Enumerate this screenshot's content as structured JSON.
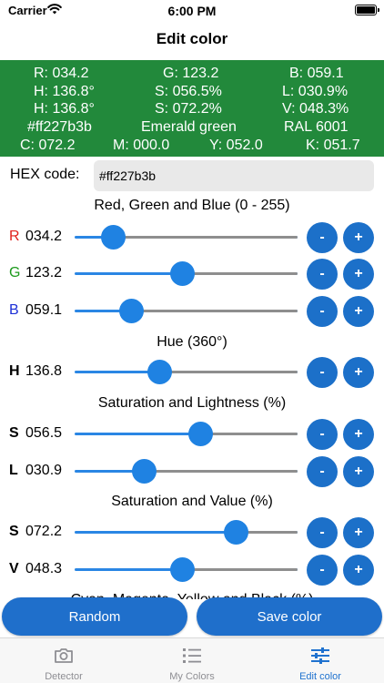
{
  "status_bar": {
    "carrier": "Carrier",
    "time": "6:00 PM"
  },
  "nav": {
    "title": "Edit color"
  },
  "color_panel": {
    "bg_color": "#22893b",
    "r": "R: 034.2",
    "g": "G: 123.2",
    "b": "B: 059.1",
    "h1": "H: 136.8°",
    "s1": "S: 056.5%",
    "l": "L: 030.9%",
    "h2": "H: 136.8°",
    "s2": "S: 072.2%",
    "v": "V: 048.3%",
    "hex": "#ff227b3b",
    "name": "Emerald green",
    "ral": "RAL 6001",
    "c": "C: 072.2",
    "m": "M: 000.0",
    "y": "Y: 052.0",
    "k": "K: 051.7"
  },
  "hex_field": {
    "label": "HEX code:",
    "value": "#ff227b3b"
  },
  "sections": {
    "rgb": "Red, Green and Blue (0 - 255)",
    "hue": "Hue (360°)",
    "sl": "Saturation and Lightness (%)",
    "sv": "Saturation and Value (%)",
    "cmyk": "Cyan, Magenta, Yellow and Black (%)"
  },
  "sliders": {
    "r": {
      "letter": "R",
      "value": "034.2",
      "fraction": 0.172,
      "color": "#e0201b"
    },
    "g": {
      "letter": "G",
      "value": "123.2",
      "fraction": 0.483,
      "color": "#1d9a1d"
    },
    "b": {
      "letter": "B",
      "value": "059.1",
      "fraction": 0.252,
      "color": "#1c2fd6"
    },
    "h": {
      "letter": "H",
      "value": "136.8",
      "fraction": 0.38,
      "color": "#000000"
    },
    "s1": {
      "letter": "S",
      "value": "056.5",
      "fraction": 0.565,
      "color": "#000000"
    },
    "l": {
      "letter": "L",
      "value": "030.9",
      "fraction": 0.309,
      "color": "#000000"
    },
    "s2": {
      "letter": "S",
      "value": "072.2",
      "fraction": 0.722,
      "color": "#000000"
    },
    "v": {
      "letter": "V",
      "value": "048.3",
      "fraction": 0.483,
      "color": "#000000"
    }
  },
  "buttons": {
    "minus": "-",
    "plus": "+",
    "random": "Random",
    "save": "Save color"
  },
  "tabs": {
    "detector": "Detector",
    "my_colors": "My Colors",
    "edit_color": "Edit color"
  },
  "accent_color": "#1f72cf"
}
